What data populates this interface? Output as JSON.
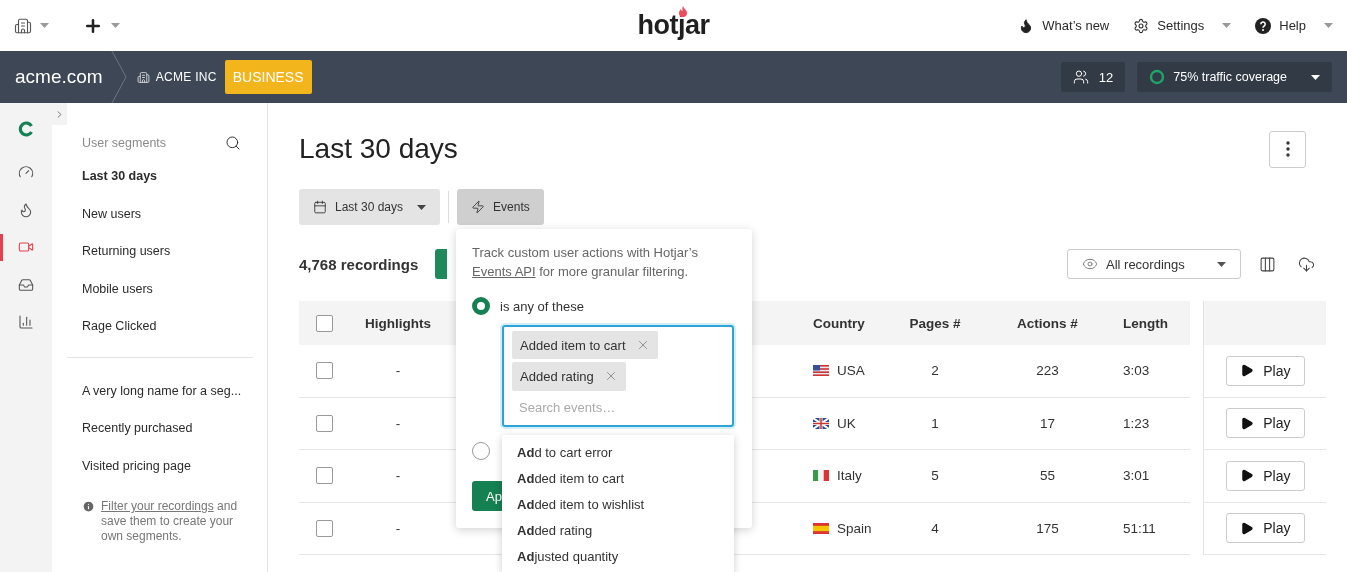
{
  "top_bar": {
    "logo": "hotjar",
    "links": [
      {
        "kind": "news",
        "label": "What’s new",
        "caret": false
      },
      {
        "kind": "settings",
        "label": "Settings",
        "caret": true
      },
      {
        "kind": "help",
        "label": "Help",
        "caret": true
      }
    ]
  },
  "site_bar": {
    "site": "acme.com",
    "org": "ACME INC",
    "plan": "BUSINESS",
    "users": "12",
    "coverage": "75% traffic coverage"
  },
  "rail": [
    {
      "kind": "dashboard",
      "selected": false
    },
    {
      "kind": "heatmaps",
      "selected": false
    },
    {
      "kind": "recordings",
      "selected": true
    },
    {
      "kind": "feedback",
      "selected": false
    },
    {
      "kind": "trends",
      "selected": false
    }
  ],
  "segments": {
    "heading": "User segments",
    "default_items": [
      {
        "label": "Last 30 days",
        "selected": true
      },
      {
        "label": "New users",
        "selected": false
      },
      {
        "label": "Returning users",
        "selected": false
      },
      {
        "label": "Mobile users",
        "selected": false
      },
      {
        "label": "Rage Clicked",
        "selected": false
      }
    ],
    "custom_items": [
      {
        "label": "A very long name for a seg...",
        "selected": false
      },
      {
        "label": "Recently purchased",
        "selected": false
      },
      {
        "label": "Visited pricing page",
        "selected": false
      }
    ],
    "note": {
      "link": "Filter your recordings",
      "text": " and save them to create your own segments."
    }
  },
  "main": {
    "title": "Last 30 days",
    "date_filter": "Last 30 days",
    "events_filter": {
      "label": "Events",
      "selected": true
    },
    "count": "4,768 recordings",
    "view": "All recordings"
  },
  "events_popover": {
    "intro_before": "Track custom user actions with Hotjar’s ",
    "intro_link": "Events API",
    "intro_after": " for more granular filtering.",
    "options": [
      {
        "label": "is any of these",
        "selected": true
      },
      {
        "selected": false
      }
    ],
    "tags": [
      "Added item to cart",
      "Added rating"
    ],
    "placeholder": "Search events…",
    "apply": "Ap",
    "suggestions": [
      "**Ad**d to cart error",
      "**Ad**ded item to cart",
      "**Ad**ded item to wishlist",
      "**Ad**ded rating",
      "**Ad**justed quantity"
    ]
  },
  "table": {
    "all_checked": false,
    "columns": [
      "Highlights",
      "Country",
      "Pages #",
      "Actions #",
      "Length"
    ],
    "rows": [
      {
        "checked": false,
        "highlights": "-",
        "kind": "us",
        "country": "USA",
        "pages": "2",
        "actions": "223",
        "length": "3:03",
        "play": "Play"
      },
      {
        "checked": false,
        "highlights": "-",
        "kind": "uk",
        "country": "UK",
        "pages": "1",
        "actions": "17",
        "length": "1:23",
        "play": "Play"
      },
      {
        "checked": false,
        "highlights": "-",
        "kind": "it",
        "country": "Italy",
        "pages": "5",
        "actions": "55",
        "length": "3:01",
        "play": "Play"
      },
      {
        "checked": false,
        "highlights": "-",
        "kind": "es",
        "country": "Spain",
        "pages": "4",
        "actions": "175",
        "length": "51:11",
        "play": "Play"
      }
    ]
  }
}
